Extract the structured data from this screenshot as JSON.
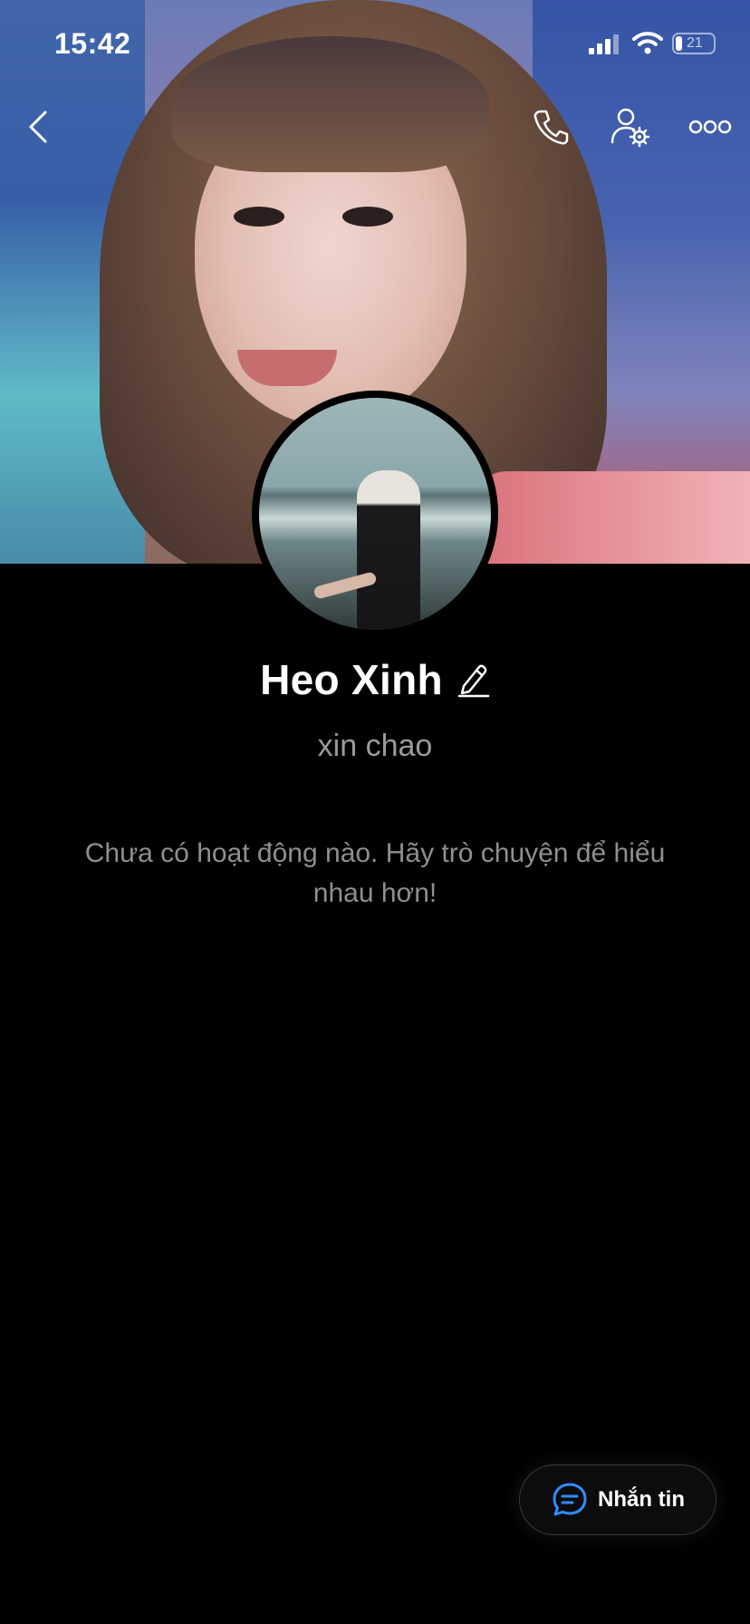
{
  "status_bar": {
    "time": "15:42",
    "battery_level": "21",
    "icons": [
      "cellular-signal-icon",
      "wifi-icon",
      "battery-icon"
    ]
  },
  "nav": {
    "icons": [
      "back-chevron-icon",
      "phone-icon",
      "user-settings-icon",
      "more-dots-icon"
    ]
  },
  "profile": {
    "name": "Heo Xinh",
    "status": "xin chao",
    "empty_activity": "Chưa có hoạt động nào. Hãy trò chuyện để hiểu nhau hơn!"
  },
  "actions": {
    "message_label": "Nhắn tin",
    "message_icon": "chat-bubble-icon",
    "accent": "#2f8dff"
  }
}
